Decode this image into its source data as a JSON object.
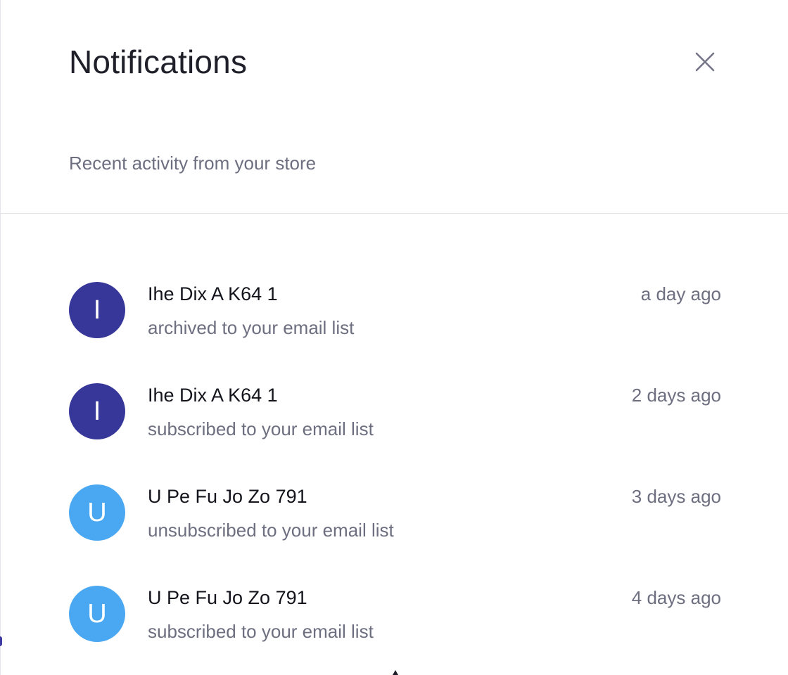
{
  "header": {
    "title": "Notifications",
    "subtitle": "Recent activity from your store",
    "close_icon": "close-icon"
  },
  "colors": {
    "avatar_indigo": "#37379a",
    "avatar_blue": "#4aa8f2",
    "text_primary": "#14151c",
    "text_muted": "#6d6f80",
    "divider": "#e3e3e8"
  },
  "notifications": [
    {
      "initial": "I",
      "name": "Ihe Dix A K64 1",
      "action": "archived to your email list",
      "time": "a day ago",
      "avatar_color": "#37379a"
    },
    {
      "initial": "I",
      "name": "Ihe Dix A K64 1",
      "action": "subscribed to your email list",
      "time": "2 days ago",
      "avatar_color": "#37379a"
    },
    {
      "initial": "U",
      "name": "U Pe Fu Jo Zo 791",
      "action": "unsubscribed to your email list",
      "time": "3 days ago",
      "avatar_color": "#4aa8f2"
    },
    {
      "initial": "U",
      "name": "U Pe Fu Jo Zo 791",
      "action": "subscribed to your email list",
      "time": "4 days ago",
      "avatar_color": "#4aa8f2"
    }
  ]
}
